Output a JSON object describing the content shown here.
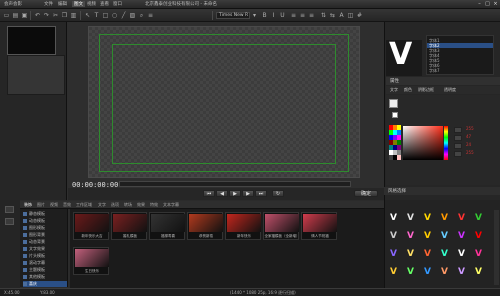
{
  "app": {
    "title_left": "会声会影",
    "menu": [
      "文件",
      "编辑",
      "图文",
      "视频",
      "查看",
      "窗口"
    ],
    "title_center": "北京鑫泰创业科技有限公司 - 未命名"
  },
  "toolbar": {
    "font_name": "Times New R"
  },
  "preview": {
    "timecode": "00:00:00:00",
    "ok_label": "确定"
  },
  "right_panel": {
    "preview_glyph": "V",
    "font_list": [
      "字体1",
      "字体2",
      "字体3",
      "字体4",
      "字体5",
      "字体6",
      "字体7"
    ],
    "prop_title": "属性",
    "prop_tabs": [
      "文字",
      "颜色",
      "阴影边框",
      "透明度"
    ],
    "color_values": [
      "255",
      "47",
      "24",
      "255"
    ],
    "style_title": "风格选择"
  },
  "library": {
    "tabs": [
      "装饰",
      "图片",
      "视频",
      "音效",
      "工作区域",
      "文字",
      "选项",
      "转场",
      "效果",
      "特效",
      "文本字幕"
    ],
    "tree": [
      "静态模板",
      "动态模板",
      "图形模板",
      "图形背景",
      "动态背景",
      "文字效果",
      "片头模板",
      "滚动字幕",
      "主题模板",
      "其他模板",
      "喜庆"
    ],
    "clips": [
      {
        "caption": "新年快乐大吉",
        "color": "#6b1a1a"
      },
      {
        "caption": "婚礼模板",
        "color": "#7a2020"
      },
      {
        "caption": "福禄寿喜",
        "color": "#333333"
      },
      {
        "caption": "恭贺新禧",
        "color": "#b23a1e"
      },
      {
        "caption": "新年快乐",
        "color": "#c3261d"
      },
      {
        "caption": "全家福模板（全新增）",
        "color": "#c0506a"
      },
      {
        "caption": "情人节祝福",
        "color": "#d13c4c"
      },
      {
        "caption": "生日快乐",
        "color": "#c2607c"
      }
    ]
  },
  "status": {
    "x": "X:45.00",
    "y": "Y:83.00",
    "info": "(1440 * 1080 25p, 16:9 逐行扫描)"
  }
}
